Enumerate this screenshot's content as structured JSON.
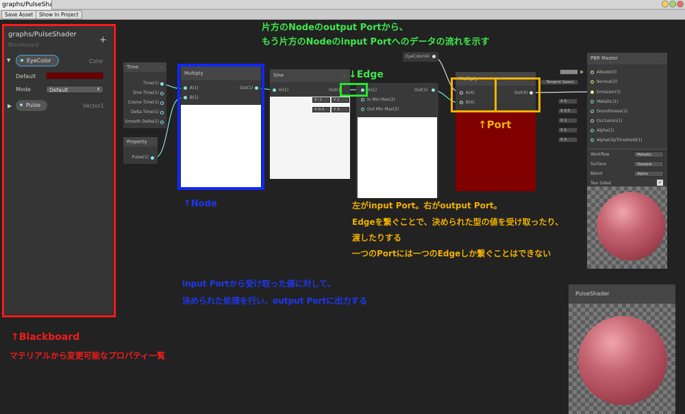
{
  "window": {
    "tab_title": "graphs/PulseSha",
    "toolbar": {
      "save_asset": "Save Asset",
      "show_in_project": "Show In Project"
    }
  },
  "blackboard": {
    "title": "graphs/PulseShader",
    "subtitle": "Blackboard",
    "add_symbol": "+",
    "properties": [
      {
        "name": "EyeColor",
        "type": "Color",
        "expanded": true
      },
      {
        "name": "Pulse",
        "type": "Vector1",
        "expanded": false
      }
    ],
    "default_label": "Default",
    "default_color": "#6a0000",
    "mode_label": "Mode",
    "mode_value": "Default"
  },
  "nodes": {
    "time": {
      "title": "Time",
      "outputs": [
        "Time(1)",
        "Sine Time(1)",
        "Cosine Time(1)",
        "Delta Time(1)",
        "Smooth Delta(1)"
      ]
    },
    "property": {
      "title": "Property",
      "output": "Pulse(1)"
    },
    "multiply1": {
      "title": "Multiply",
      "inputs": [
        "A(1)",
        "B(1)"
      ],
      "output": "Out(1)"
    },
    "sine": {
      "title": "Sine",
      "input": "In(1)",
      "output": "Out(1)",
      "field_x": "X -1",
      "field_y": "Y 1",
      "field2_x": "X 0.3",
      "field2_y": "Y 3"
    },
    "remap": {
      "inputs": [
        "In(1)",
        "In Min Max(2)",
        "Out Min Max(2)"
      ],
      "output": "Out(1)"
    },
    "eyecolor": {
      "output": "EyeColor(4)"
    },
    "multiply2": {
      "title": "Multiply",
      "inputs": [
        "A(4)",
        "B(4)"
      ],
      "output": "Out(4)",
      "preview_color": "#800000"
    },
    "pbr": {
      "title": "PBR Master",
      "tangent_space": "Tangent Space",
      "inputs": [
        "Albedo(3)",
        "Normal(3)",
        "Emission(3)",
        "Metallic(1)",
        "Smoothness(1)",
        "Occlusion(1)",
        "Alpha(1)",
        "AlphaClipThreshold(1)"
      ],
      "input_values": [
        "",
        "",
        "",
        "X 0",
        "X 0.5",
        "X 1",
        "X 1",
        "X 0"
      ],
      "settings": [
        {
          "label": "Workflow",
          "value": "Metallic"
        },
        {
          "label": "Surface",
          "value": "Opaque"
        },
        {
          "label": "Blend",
          "value": "Alpha"
        }
      ],
      "two_sided_label": "Two Sided",
      "two_sided_checked": true
    },
    "preview": {
      "title": "PulseShader"
    }
  },
  "annotations": {
    "edge_header_line1": "片方のNodeのoutput Portから、",
    "edge_header_line2": "もう片方のNodeのinput Portへのデータの流れを示す",
    "edge_label": "↓Edge",
    "node_label": "↑Node",
    "port_label": "↑Port",
    "port_desc": [
      "左がinput Port。右がoutput Port。",
      "Edgeを繋ぐことで、決められた型の値を受け取ったり、",
      "渡したりする",
      "一つのPortには一つのEdgeしか繋ぐことはできない"
    ],
    "node_desc": [
      "input Portから受け取った値に対して、",
      "決められた処理を行い、output Portに出力する"
    ],
    "blackboard_label": "↑Blackboard",
    "blackboard_desc": "マテリアルから変更可能なプロパティ一覧"
  },
  "colors": {
    "annotation_green": "#3ee84a",
    "annotation_blue": "#1f37f0",
    "annotation_orange": "#f0b000",
    "annotation_red": "#f01c1c",
    "port_cyan": "#84e4e7",
    "port_yellow": "#f0f08a"
  }
}
